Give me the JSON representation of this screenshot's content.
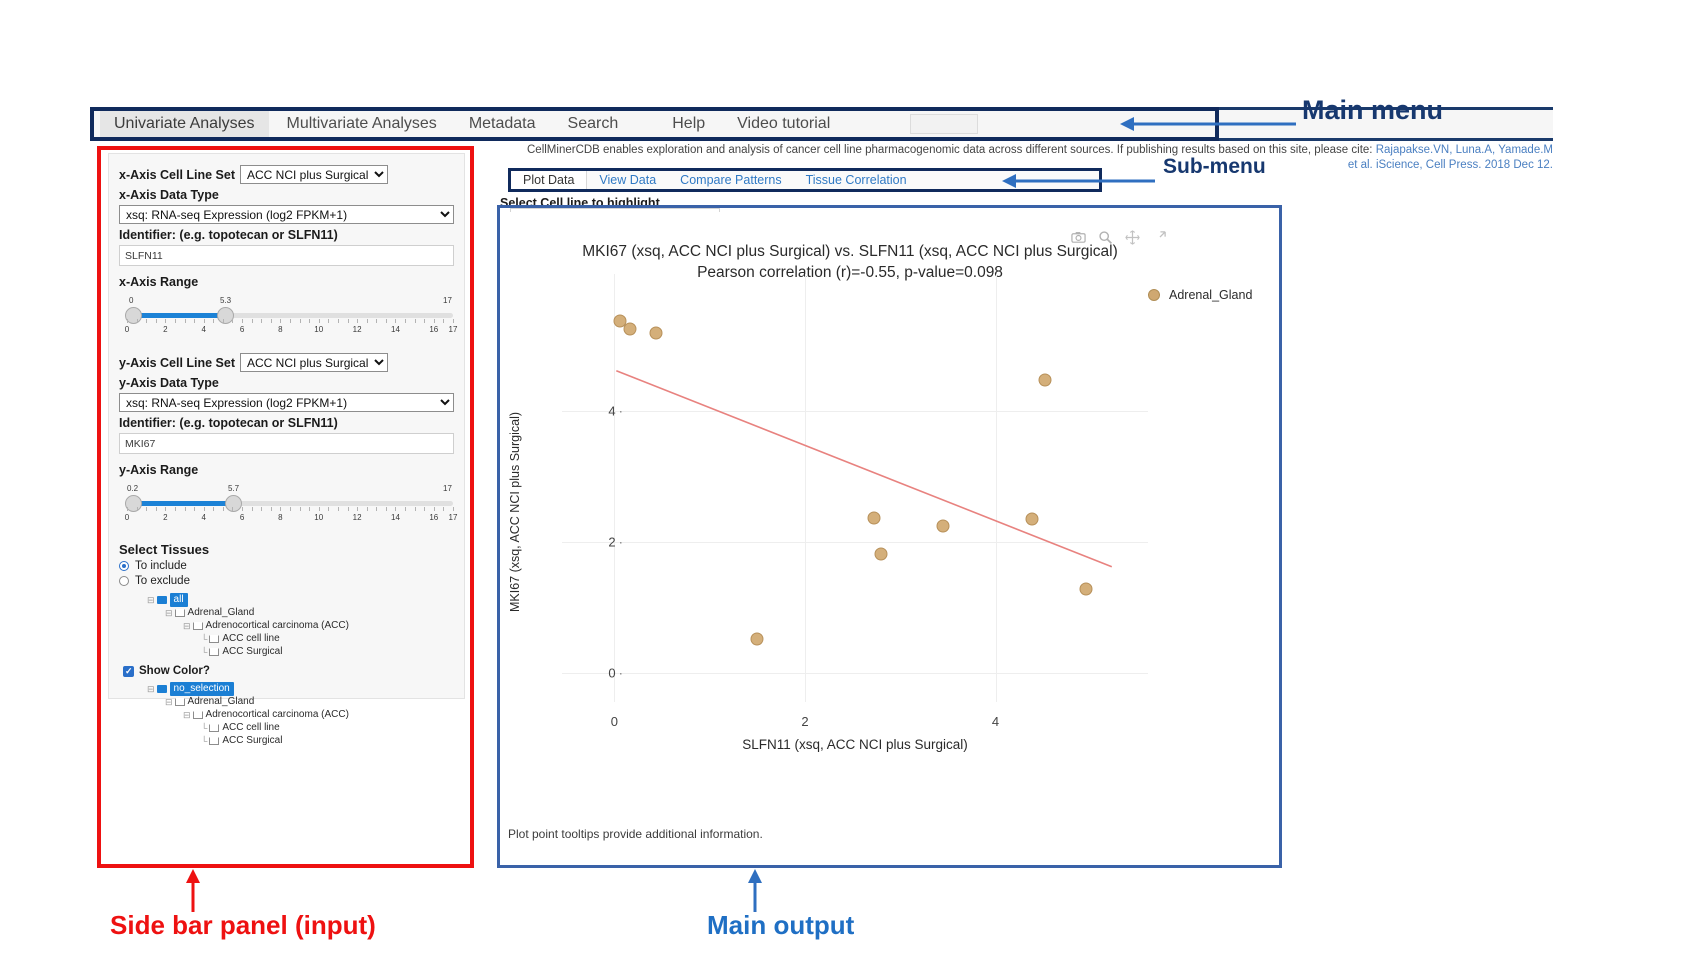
{
  "main_menu": {
    "items": [
      {
        "label": "Univariate Analyses",
        "active": true
      },
      {
        "label": "Multivariate Analyses",
        "active": false
      },
      {
        "label": "Metadata",
        "active": false
      },
      {
        "label": "Search",
        "active": false
      },
      {
        "label": "Help",
        "active": false
      },
      {
        "label": "Video tutorial",
        "active": false
      }
    ],
    "search_value": ""
  },
  "citation": {
    "line1": "CellMinerCDB enables exploration and analysis of cancer cell line pharmacogenomic data across different sources. If publishing results based on this site, please cite:",
    "authors": "Rajapakse.VN, Luna.A, Yamade.M",
    "line2_prefix": "et al. iScience, Cell Press. 2018 Dec 12."
  },
  "sidebar": {
    "x_cellline_label": "x-Axis Cell Line Set",
    "x_cellline_value": "ACC NCI plus Surgical",
    "x_datatype_label": "x-Axis Data Type",
    "x_datatype_value": "xsq: RNA-seq Expression (log2 FPKM+1)",
    "x_identifier_label": "Identifier: (e.g. topotecan or SLFN11)",
    "x_identifier_value": "SLFN11",
    "x_range_label": "x-Axis Range",
    "x_range_low": "0",
    "x_range_high": "5.3",
    "x_range_max": "17",
    "y_cellline_label": "y-Axis Cell Line Set",
    "y_cellline_value": "ACC NCI plus Surgical",
    "y_datatype_label": "y-Axis Data Type",
    "y_datatype_value": "xsq: RNA-seq Expression (log2 FPKM+1)",
    "y_identifier_label": "Identifier: (e.g. topotecan or SLFN11)",
    "y_identifier_value": "MKI67",
    "y_range_label": "y-Axis Range",
    "y_range_low": "0.2",
    "y_range_high": "5.7",
    "y_range_max": "17",
    "slider_ticks": [
      "0",
      "2",
      "4",
      "6",
      "8",
      "10",
      "12",
      "14",
      "16",
      "17"
    ],
    "select_tissues_label": "Select Tissues",
    "radio_include": "To include",
    "radio_exclude": "To exclude",
    "radio_selected": "include",
    "tree_include": [
      {
        "label": "all",
        "depth": 0,
        "selected": true,
        "folder": "blue"
      },
      {
        "label": "Adrenal_Gland",
        "depth": 1,
        "selected": false,
        "folder": "open"
      },
      {
        "label": "Adrenocortical carcinoma (ACC)",
        "depth": 2,
        "selected": false,
        "folder": "open"
      },
      {
        "label": "ACC cell line",
        "depth": 3,
        "selected": false,
        "folder": "open"
      },
      {
        "label": "ACC Surgical",
        "depth": 3,
        "selected": false,
        "folder": "open"
      }
    ],
    "show_color_label": "Show Color?",
    "show_color_checked": true,
    "tree_exclude": [
      {
        "label": "no_selection",
        "depth": 0,
        "selected": true,
        "folder": "blue"
      },
      {
        "label": "Adrenal_Gland",
        "depth": 1,
        "selected": false,
        "folder": "open"
      },
      {
        "label": "Adrenocortical carcinoma (ACC)",
        "depth": 2,
        "selected": false,
        "folder": "open"
      },
      {
        "label": "ACC cell line",
        "depth": 3,
        "selected": false,
        "folder": "open"
      },
      {
        "label": "ACC Surgical",
        "depth": 3,
        "selected": false,
        "folder": "open"
      }
    ]
  },
  "submenu": {
    "items": [
      {
        "label": "Plot Data",
        "active": true
      },
      {
        "label": "View Data",
        "active": false
      },
      {
        "label": "Compare Patterns",
        "active": false
      },
      {
        "label": "Tissue Correlation",
        "active": false
      }
    ]
  },
  "main_output": {
    "highlight_label": "Select Cell line to highlight",
    "highlight_value": "",
    "footnote": "Plot point tooltips provide additional information.",
    "modebar": [
      "camera-icon",
      "zoom-icon",
      "pan-icon",
      "reset-axes-icon"
    ]
  },
  "annotations": {
    "main_menu": "Main menu",
    "sub_menu": "Sub-menu",
    "sidebar": "Side bar panel (input)",
    "main_output": "Main output",
    "color_red": "#ee1111",
    "color_blue": "#17386f"
  },
  "chart_data": {
    "type": "scatter",
    "title_line1": "MKI67 (xsq, ACC NCI plus Surgical) vs. SLFN11 (xsq, ACC NCI plus Surgical)",
    "title_line2": "Pearson correlation (r)=-0.55, p-value=0.098",
    "xlabel": "SLFN11 (xsq, ACC NCI plus Surgical)",
    "ylabel": "MKI67 (xsq, ACC NCI plus Surgical)",
    "xlim": [
      -0.55,
      5.6
    ],
    "ylim": [
      -0.45,
      6.1
    ],
    "xticks": [
      0,
      2,
      4
    ],
    "yticks": [
      0,
      2,
      4
    ],
    "grid": true,
    "legend_position": "top-right",
    "series": [
      {
        "name": "Adrenal_Gland",
        "color": "#d4af7a",
        "points": [
          {
            "x": 0.06,
            "y": 5.38
          },
          {
            "x": 0.16,
            "y": 5.26
          },
          {
            "x": 0.44,
            "y": 5.2
          },
          {
            "x": 4.52,
            "y": 4.48
          },
          {
            "x": 2.72,
            "y": 2.37
          },
          {
            "x": 3.45,
            "y": 2.25
          },
          {
            "x": 4.38,
            "y": 2.35
          },
          {
            "x": 2.8,
            "y": 1.82
          },
          {
            "x": 4.95,
            "y": 1.28
          },
          {
            "x": 1.5,
            "y": 0.52
          }
        ]
      }
    ],
    "trendline": {
      "color": "#e8827f",
      "x0": 0.02,
      "y0": 4.62,
      "x1": 5.22,
      "y1": 1.62
    }
  }
}
